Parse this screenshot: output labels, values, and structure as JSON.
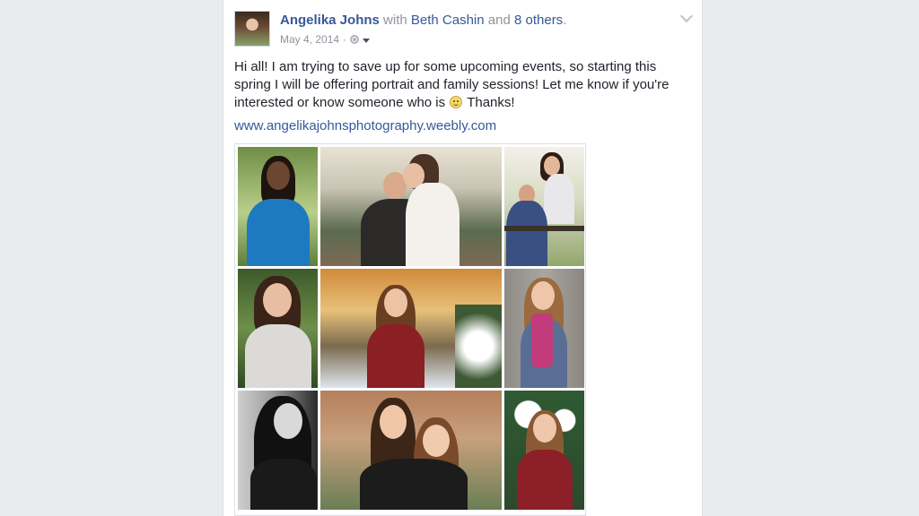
{
  "post": {
    "author": "Angelika Johns",
    "with_word": "with",
    "tagged_friend": "Beth Cashin",
    "and_word": "and",
    "others": "8 others",
    "period": ".",
    "date": "May 4, 2014",
    "dot": "·",
    "text_before_emoji": "Hi all! I am trying to save up for some upcoming events, so starting this spring I will be offering portrait and family sessions! Let me know if you're interested or know someone who is",
    "text_after_emoji": "Thanks!",
    "link": "www.angelikajohnsphotography.weebly.com"
  },
  "icons": {
    "avatar": "profile-photo",
    "privacy": "globe-icon",
    "audience_dropdown": "caret-down-icon",
    "options": "chevron-down-icon",
    "emoji": "smiley-emoji-icon"
  },
  "colors": {
    "link": "#365899",
    "body_text": "#1d2129",
    "meta_text": "#90949c",
    "page_background": "#e9ebee"
  }
}
